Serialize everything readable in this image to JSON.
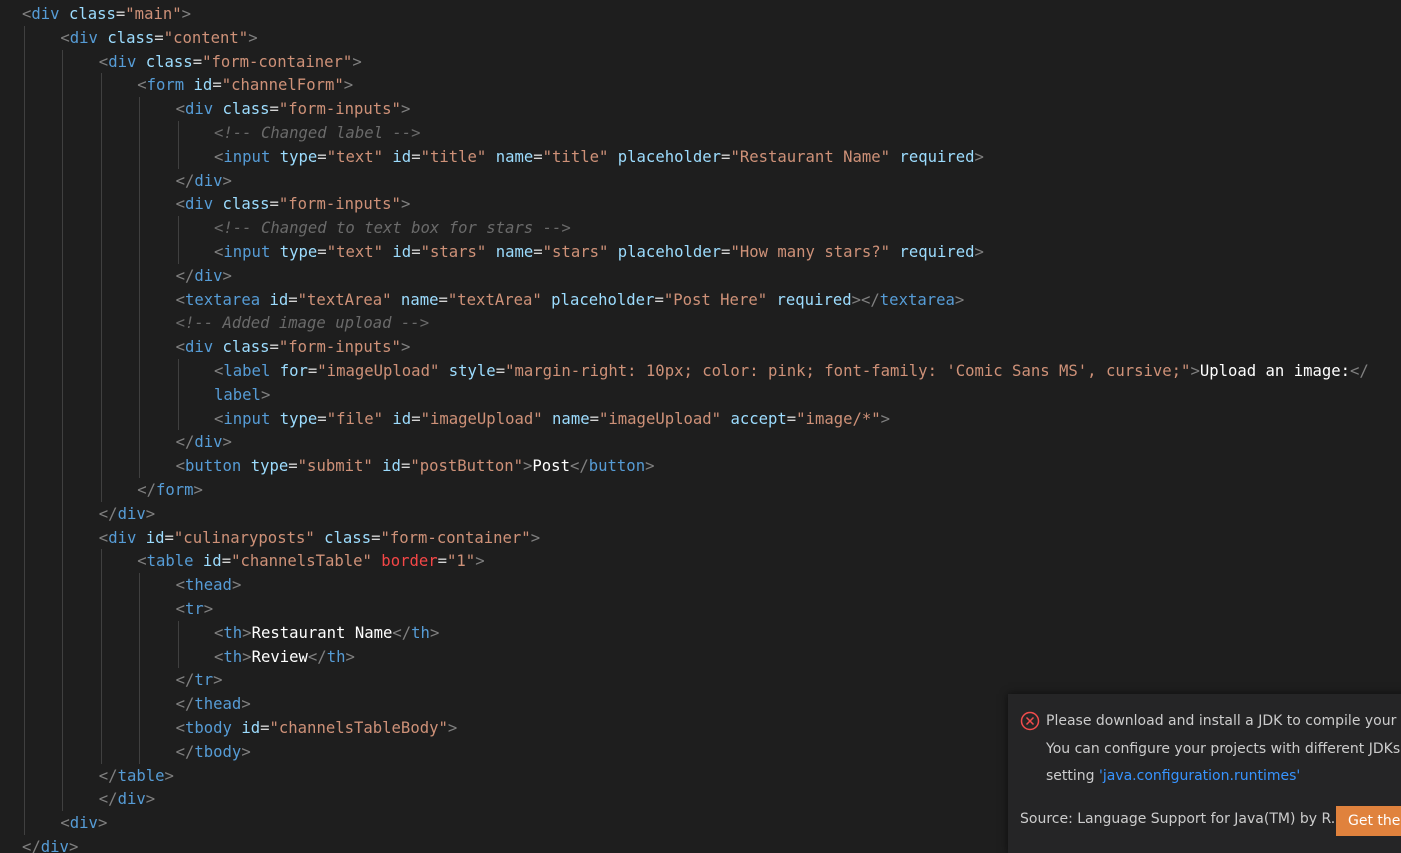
{
  "editor": {
    "lines": [
      {
        "indent": 0,
        "tokens": [
          [
            "p",
            "<"
          ],
          [
            "t",
            "div"
          ],
          [
            "a",
            " class"
          ],
          [
            "e",
            "="
          ],
          [
            "s",
            "\"main\""
          ],
          [
            "p",
            ">"
          ]
        ]
      },
      {
        "indent": 1,
        "tokens": [
          [
            "p",
            "<"
          ],
          [
            "t",
            "div"
          ],
          [
            "a",
            " class"
          ],
          [
            "e",
            "="
          ],
          [
            "s",
            "\"content\""
          ],
          [
            "p",
            ">"
          ]
        ]
      },
      {
        "indent": 2,
        "tokens": [
          [
            "p",
            "<"
          ],
          [
            "t",
            "div"
          ],
          [
            "a",
            " class"
          ],
          [
            "e",
            "="
          ],
          [
            "s",
            "\"form-container\""
          ],
          [
            "p",
            ">"
          ]
        ]
      },
      {
        "indent": 3,
        "tokens": [
          [
            "p",
            "<"
          ],
          [
            "t",
            "form"
          ],
          [
            "a",
            " id"
          ],
          [
            "e",
            "="
          ],
          [
            "s",
            "\"channelForm\""
          ],
          [
            "p",
            ">"
          ]
        ]
      },
      {
        "indent": 4,
        "tokens": [
          [
            "p",
            "<"
          ],
          [
            "t",
            "div"
          ],
          [
            "a",
            " class"
          ],
          [
            "e",
            "="
          ],
          [
            "s",
            "\"form-inputs\""
          ],
          [
            "p",
            ">"
          ]
        ]
      },
      {
        "indent": 5,
        "tokens": [
          [
            "c",
            "<!-- Changed label -->"
          ]
        ]
      },
      {
        "indent": 5,
        "tokens": [
          [
            "p",
            "<"
          ],
          [
            "t",
            "input"
          ],
          [
            "a",
            " type"
          ],
          [
            "e",
            "="
          ],
          [
            "s",
            "\"text\""
          ],
          [
            "a",
            " id"
          ],
          [
            "e",
            "="
          ],
          [
            "s",
            "\"title\""
          ],
          [
            "a",
            " name"
          ],
          [
            "e",
            "="
          ],
          [
            "s",
            "\"title\""
          ],
          [
            "a",
            " placeholder"
          ],
          [
            "e",
            "="
          ],
          [
            "s",
            "\"Restaurant Name\""
          ],
          [
            "a",
            " required"
          ],
          [
            "p",
            ">"
          ]
        ]
      },
      {
        "indent": 4,
        "tokens": [
          [
            "p",
            "</"
          ],
          [
            "t",
            "div"
          ],
          [
            "p",
            ">"
          ]
        ]
      },
      {
        "indent": 4,
        "tokens": [
          [
            "p",
            "<"
          ],
          [
            "t",
            "div"
          ],
          [
            "a",
            " class"
          ],
          [
            "e",
            "="
          ],
          [
            "s",
            "\"form-inputs\""
          ],
          [
            "p",
            ">"
          ]
        ]
      },
      {
        "indent": 5,
        "tokens": [
          [
            "c",
            "<!-- Changed to text box for stars -->"
          ]
        ]
      },
      {
        "indent": 5,
        "tokens": [
          [
            "p",
            "<"
          ],
          [
            "t",
            "input"
          ],
          [
            "a",
            " type"
          ],
          [
            "e",
            "="
          ],
          [
            "s",
            "\"text\""
          ],
          [
            "a",
            " id"
          ],
          [
            "e",
            "="
          ],
          [
            "s",
            "\"stars\""
          ],
          [
            "a",
            " name"
          ],
          [
            "e",
            "="
          ],
          [
            "s",
            "\"stars\""
          ],
          [
            "a",
            " placeholder"
          ],
          [
            "e",
            "="
          ],
          [
            "s",
            "\"How many stars?\""
          ],
          [
            "a",
            " required"
          ],
          [
            "p",
            ">"
          ]
        ]
      },
      {
        "indent": 4,
        "tokens": [
          [
            "p",
            "</"
          ],
          [
            "t",
            "div"
          ],
          [
            "p",
            ">"
          ]
        ]
      },
      {
        "indent": 4,
        "tokens": [
          [
            "p",
            "<"
          ],
          [
            "t",
            "textarea"
          ],
          [
            "a",
            " id"
          ],
          [
            "e",
            "="
          ],
          [
            "s",
            "\"textArea\""
          ],
          [
            "a",
            " name"
          ],
          [
            "e",
            "="
          ],
          [
            "s",
            "\"textArea\""
          ],
          [
            "a",
            " placeholder"
          ],
          [
            "e",
            "="
          ],
          [
            "s",
            "\"Post Here\""
          ],
          [
            "a",
            " required"
          ],
          [
            "p",
            "></"
          ],
          [
            "t",
            "textarea"
          ],
          [
            "p",
            ">"
          ]
        ]
      },
      {
        "indent": 4,
        "tokens": [
          [
            "c",
            "<!-- Added image upload -->"
          ]
        ]
      },
      {
        "indent": 4,
        "tokens": [
          [
            "p",
            "<"
          ],
          [
            "t",
            "div"
          ],
          [
            "a",
            " class"
          ],
          [
            "e",
            "="
          ],
          [
            "s",
            "\"form-inputs\""
          ],
          [
            "p",
            ">"
          ]
        ]
      },
      {
        "indent": 5,
        "tokens": [
          [
            "p",
            "<"
          ],
          [
            "t",
            "label"
          ],
          [
            "a",
            " for"
          ],
          [
            "e",
            "="
          ],
          [
            "s",
            "\"imageUpload\""
          ],
          [
            "a",
            " style"
          ],
          [
            "e",
            "="
          ],
          [
            "s",
            "\"margin-right: 10px; color: pink; font-family: 'Comic Sans MS', cursive;\""
          ],
          [
            "p",
            ">"
          ],
          [
            "x",
            "Upload an image:"
          ],
          [
            "p",
            "</"
          ]
        ]
      },
      {
        "indent": 5,
        "tokens": [
          [
            "t",
            "label"
          ],
          [
            "p",
            ">"
          ]
        ]
      },
      {
        "indent": 5,
        "tokens": [
          [
            "p",
            "<"
          ],
          [
            "t",
            "input"
          ],
          [
            "a",
            " type"
          ],
          [
            "e",
            "="
          ],
          [
            "s",
            "\"file\""
          ],
          [
            "a",
            " id"
          ],
          [
            "e",
            "="
          ],
          [
            "s",
            "\"imageUpload\""
          ],
          [
            "a",
            " name"
          ],
          [
            "e",
            "="
          ],
          [
            "s",
            "\"imageUpload\""
          ],
          [
            "a",
            " accept"
          ],
          [
            "e",
            "="
          ],
          [
            "s",
            "\"image/*\""
          ],
          [
            "p",
            ">"
          ]
        ]
      },
      {
        "indent": 4,
        "tokens": [
          [
            "p",
            "</"
          ],
          [
            "t",
            "div"
          ],
          [
            "p",
            ">"
          ]
        ]
      },
      {
        "indent": 4,
        "tokens": [
          [
            "p",
            "<"
          ],
          [
            "t",
            "button"
          ],
          [
            "a",
            " type"
          ],
          [
            "e",
            "="
          ],
          [
            "s",
            "\"submit\""
          ],
          [
            "a",
            " id"
          ],
          [
            "e",
            "="
          ],
          [
            "s",
            "\"postButton\""
          ],
          [
            "p",
            ">"
          ],
          [
            "x",
            "Post"
          ],
          [
            "p",
            "</"
          ],
          [
            "t",
            "button"
          ],
          [
            "p",
            ">"
          ]
        ]
      },
      {
        "indent": 3,
        "tokens": [
          [
            "p",
            "</"
          ],
          [
            "t",
            "form"
          ],
          [
            "p",
            ">"
          ]
        ]
      },
      {
        "indent": 2,
        "tokens": [
          [
            "p",
            "</"
          ],
          [
            "t",
            "div"
          ],
          [
            "p",
            ">"
          ]
        ]
      },
      {
        "indent": 2,
        "tokens": [
          [
            "p",
            "<"
          ],
          [
            "t",
            "div"
          ],
          [
            "a",
            " id"
          ],
          [
            "e",
            "="
          ],
          [
            "s",
            "\"culinaryposts\""
          ],
          [
            "a",
            " class"
          ],
          [
            "e",
            "="
          ],
          [
            "s",
            "\"form-container\""
          ],
          [
            "p",
            ">"
          ]
        ]
      },
      {
        "indent": 3,
        "tokens": [
          [
            "p",
            "<"
          ],
          [
            "t",
            "table"
          ],
          [
            "a",
            " id"
          ],
          [
            "e",
            "="
          ],
          [
            "s",
            "\"channelsTable\""
          ],
          [
            "b",
            " border"
          ],
          [
            "e",
            "="
          ],
          [
            "s",
            "\"1\""
          ],
          [
            "p",
            ">"
          ]
        ]
      },
      {
        "indent": 4,
        "tokens": [
          [
            "p",
            "<"
          ],
          [
            "t",
            "thead"
          ],
          [
            "p",
            ">"
          ]
        ]
      },
      {
        "indent": 4,
        "tokens": [
          [
            "p",
            "<"
          ],
          [
            "t",
            "tr"
          ],
          [
            "p",
            ">"
          ]
        ]
      },
      {
        "indent": 5,
        "tokens": [
          [
            "p",
            "<"
          ],
          [
            "t",
            "th"
          ],
          [
            "p",
            ">"
          ],
          [
            "x",
            "Restaurant Name"
          ],
          [
            "p",
            "</"
          ],
          [
            "t",
            "th"
          ],
          [
            "p",
            ">"
          ]
        ]
      },
      {
        "indent": 5,
        "tokens": [
          [
            "p",
            "<"
          ],
          [
            "t",
            "th"
          ],
          [
            "p",
            ">"
          ],
          [
            "x",
            "Review"
          ],
          [
            "p",
            "</"
          ],
          [
            "t",
            "th"
          ],
          [
            "p",
            ">"
          ]
        ]
      },
      {
        "indent": 4,
        "tokens": [
          [
            "p",
            "</"
          ],
          [
            "t",
            "tr"
          ],
          [
            "p",
            ">"
          ]
        ]
      },
      {
        "indent": 4,
        "tokens": [
          [
            "p",
            "</"
          ],
          [
            "t",
            "thead"
          ],
          [
            "p",
            ">"
          ]
        ]
      },
      {
        "indent": 4,
        "tokens": [
          [
            "p",
            "<"
          ],
          [
            "t",
            "tbody"
          ],
          [
            "a",
            " id"
          ],
          [
            "e",
            "="
          ],
          [
            "s",
            "\"channelsTableBody\""
          ],
          [
            "p",
            ">"
          ]
        ]
      },
      {
        "indent": 4,
        "tokens": [
          [
            "p",
            "</"
          ],
          [
            "t",
            "tbody"
          ],
          [
            "p",
            ">"
          ]
        ]
      },
      {
        "indent": 2,
        "tokens": [
          [
            "p",
            "</"
          ],
          [
            "t",
            "table"
          ],
          [
            "p",
            ">"
          ]
        ]
      },
      {
        "indent": 2,
        "tokens": [
          [
            "p",
            "</"
          ],
          [
            "t",
            "div"
          ],
          [
            "p",
            ">"
          ]
        ]
      },
      {
        "indent": 1,
        "tokens": [
          [
            "p",
            "<"
          ],
          [
            "t",
            "div"
          ],
          [
            "p",
            ">"
          ]
        ]
      },
      {
        "indent": 0,
        "tokens": [
          [
            "p",
            "</"
          ],
          [
            "t",
            "div"
          ],
          [
            "p",
            ">"
          ]
        ]
      }
    ]
  },
  "notification": {
    "icon": "error-circle-icon",
    "message_line1": "Please download and install a JDK to compile your project.",
    "message_line2": "You can configure your projects with different JDKs by the",
    "message_line3_prefix": "setting ",
    "message_link": "'java.configuration.runtimes'",
    "source": "Source: Language Support for Java(TM) by R...",
    "button_label": "Get the Java Development Kit",
    "icon_color": "#f14c4c",
    "button_color": "#e0823d"
  }
}
